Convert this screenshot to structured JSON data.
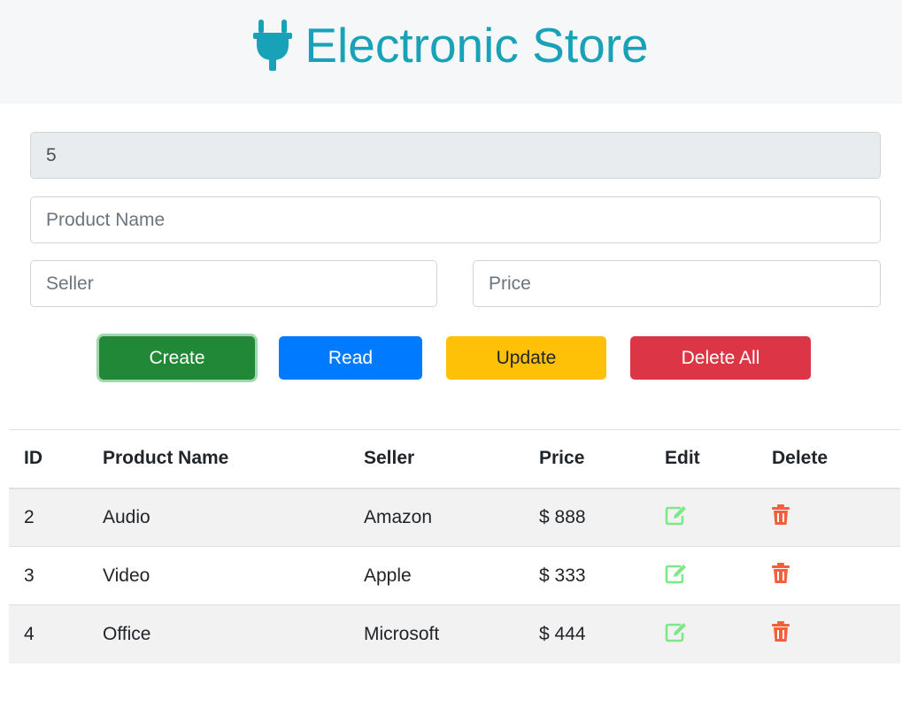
{
  "header": {
    "title": "Electronic Store",
    "icon": "plug-icon",
    "color": "#17a2b8"
  },
  "form": {
    "id_value": "5",
    "name_placeholder": "Product Name",
    "seller_placeholder": "Seller",
    "price_placeholder": "Price"
  },
  "buttons": {
    "create": "Create",
    "read": "Read",
    "update": "Update",
    "delete_all": "Delete All"
  },
  "table": {
    "headers": [
      "ID",
      "Product Name",
      "Seller",
      "Price",
      "Edit",
      "Delete"
    ],
    "rows": [
      {
        "id": "2",
        "name": "Audio",
        "seller": "Amazon",
        "price": "$ 888"
      },
      {
        "id": "3",
        "name": "Video",
        "seller": "Apple",
        "price": "$ 333"
      },
      {
        "id": "4",
        "name": "Office",
        "seller": "Microsoft",
        "price": "$ 444"
      }
    ],
    "edit_icon": "edit-icon",
    "delete_icon": "trash-icon",
    "edit_color": "#7ee787",
    "delete_color": "#f25f3a"
  }
}
